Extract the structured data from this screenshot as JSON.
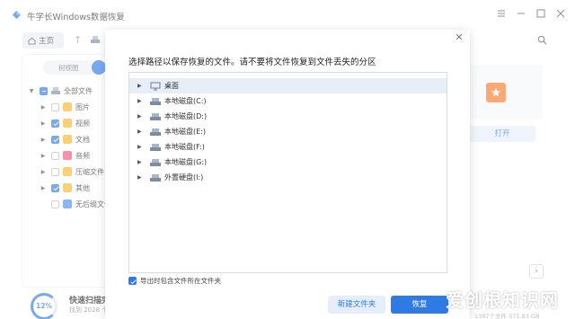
{
  "app": {
    "title": "牛学长Windows数据恢复",
    "nav": {
      "home_label": "主页"
    },
    "view_toggle_label": "树视图",
    "tree": [
      {
        "label": "全部文件",
        "state": "partial",
        "expanded": true,
        "icon": "drive-icon"
      },
      {
        "label": "图片",
        "state": "unchecked",
        "icon": "image-folder-icon",
        "color": "#f5b82e"
      },
      {
        "label": "视频",
        "state": "checked",
        "icon": "video-folder-icon",
        "color": "#f5b82e"
      },
      {
        "label": "文档",
        "state": "checked",
        "icon": "document-folder-icon",
        "color": "#f5b82e"
      },
      {
        "label": "音频",
        "state": "unchecked",
        "icon": "audio-folder-icon",
        "color": "#f0587a"
      },
      {
        "label": "压缩文件",
        "state": "unchecked",
        "icon": "archive-folder-icon",
        "color": "#f5b82e"
      },
      {
        "label": "其他",
        "state": "checked",
        "icon": "other-folder-icon",
        "color": "#f5b82e"
      },
      {
        "label": "无后缀文件",
        "state": "unchecked",
        "icon": "unknown-file-icon",
        "color": "#4c8ff0"
      }
    ],
    "open_button_label": "打开",
    "scan": {
      "percent_label": "12%",
      "title": "快速扫描完",
      "subtitle": "找到 2028 个"
    },
    "status_text": "1397个文件 571.83 GB",
    "colors": {
      "accent": "#2f7be6",
      "file_thumb": "#f97a2b"
    }
  },
  "dialog": {
    "title": "选择路径以保存恢复的文件。请不要将文件恢复到文件丢失的分区",
    "locations": [
      {
        "label": "桌面",
        "icon": "desktop-icon",
        "selected": true
      },
      {
        "label": "本地磁盘(C:)",
        "icon": "drive-icon"
      },
      {
        "label": "本地磁盘(D:)",
        "icon": "drive-icon"
      },
      {
        "label": "本地磁盘(E:)",
        "icon": "drive-icon"
      },
      {
        "label": "本地磁盘(F:)",
        "icon": "drive-icon"
      },
      {
        "label": "本地磁盘(G:)",
        "icon": "drive-icon"
      },
      {
        "label": "外置硬盘(I:)",
        "icon": "drive-icon"
      }
    ],
    "export_option": {
      "label": "导出时包含文件所在文件夹",
      "checked": true
    },
    "buttons": {
      "new_folder": "新建文件夹",
      "recover": "恢复"
    }
  },
  "watermark": "爱创根知识网"
}
